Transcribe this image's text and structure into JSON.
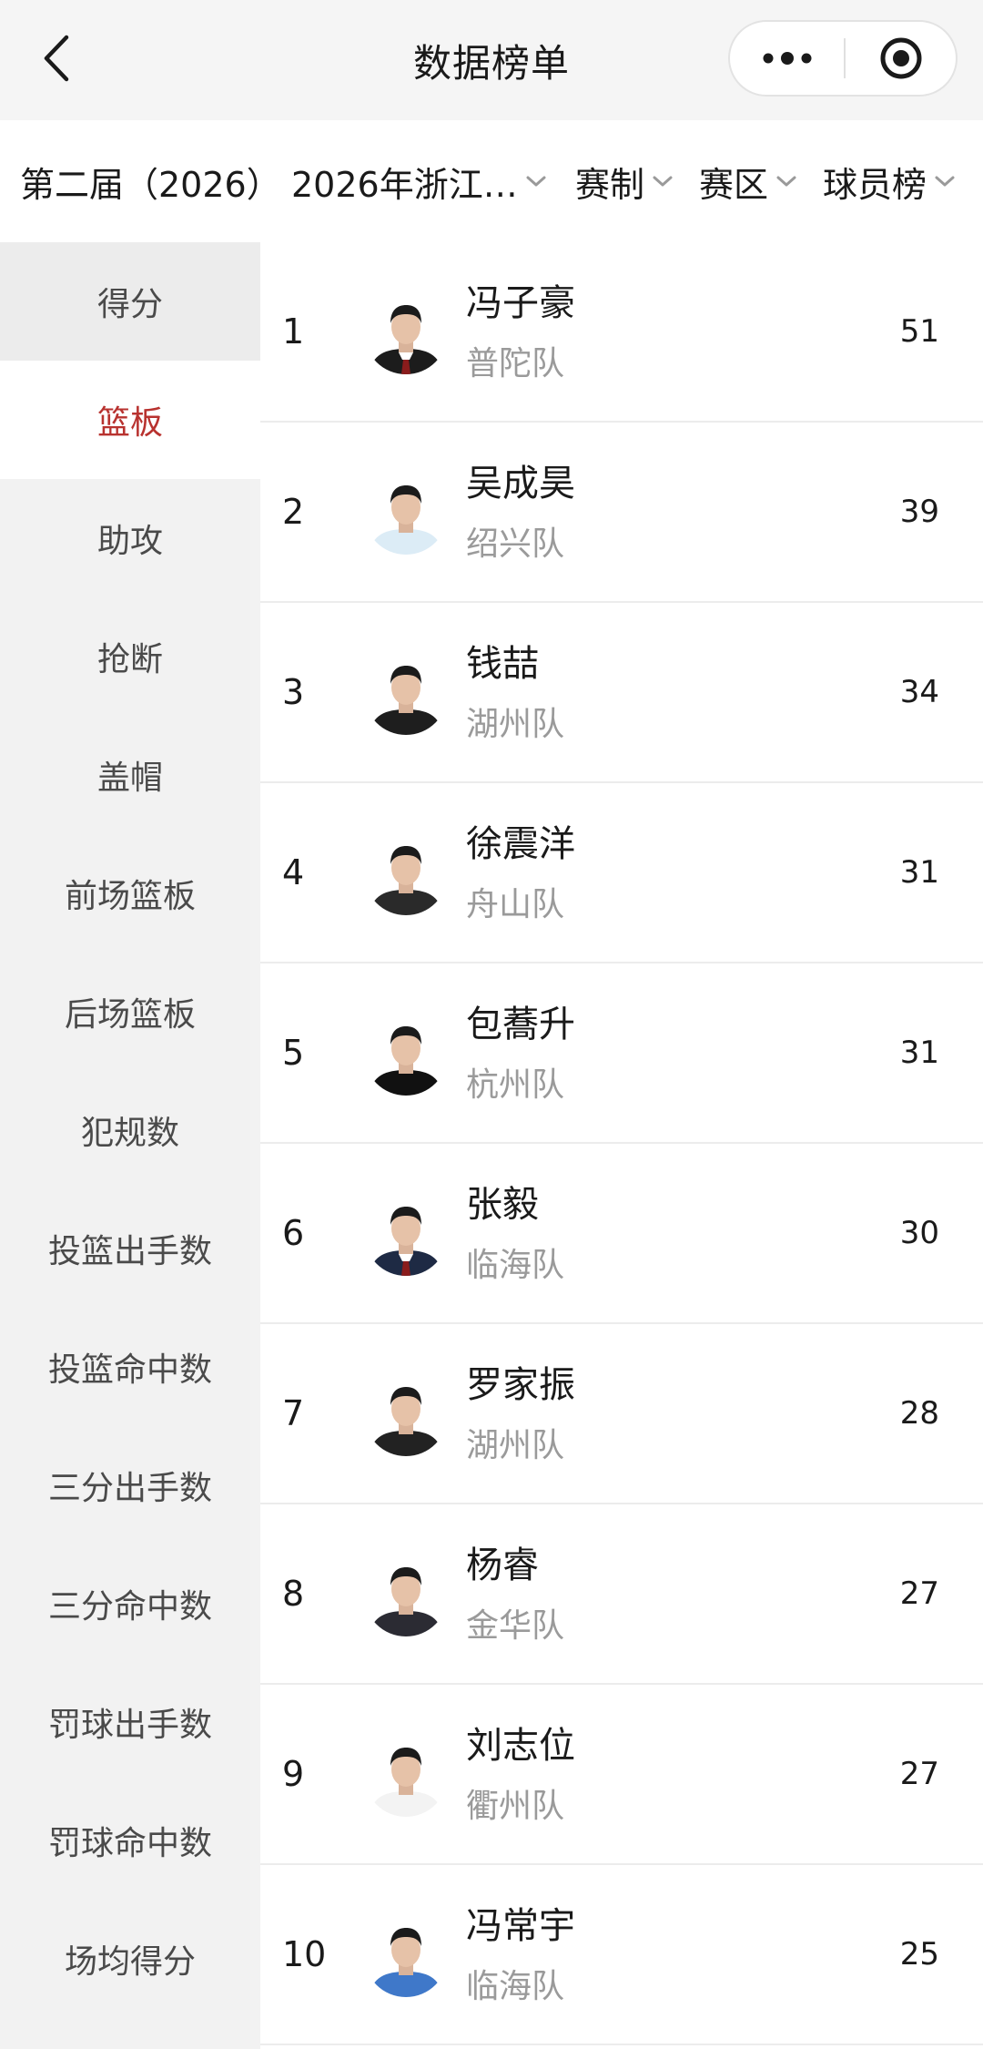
{
  "header": {
    "title": "数据榜单",
    "back_icon": "chevron-left-icon",
    "more_icon": "more-dots-icon",
    "target_icon": "record-target-icon"
  },
  "filters": {
    "season": "第二届（2026）",
    "league": "2026年浙江…",
    "format": "赛制",
    "region": "赛区",
    "board": "球员榜"
  },
  "sidebar": {
    "items": [
      {
        "label": "得分"
      },
      {
        "label": "篮板"
      },
      {
        "label": "助攻"
      },
      {
        "label": "抢断"
      },
      {
        "label": "盖帽"
      },
      {
        "label": "前场篮板"
      },
      {
        "label": "后场篮板"
      },
      {
        "label": "犯规数"
      },
      {
        "label": "投篮出手数"
      },
      {
        "label": "投篮命中数"
      },
      {
        "label": "三分出手数"
      },
      {
        "label": "三分命中数"
      },
      {
        "label": "罚球出手数"
      },
      {
        "label": "罚球命中数"
      },
      {
        "label": "场均得分"
      }
    ],
    "active_index": 1,
    "active_color": "#b8322f"
  },
  "ranking": {
    "rows": [
      {
        "rank": "1",
        "name": "冯子豪",
        "team": "普陀队",
        "value": "51",
        "shirt": "#1c1c1c",
        "tie": true
      },
      {
        "rank": "2",
        "name": "吴成昊",
        "team": "绍兴队",
        "value": "39",
        "shirt": "#dcecf6",
        "tie": false
      },
      {
        "rank": "3",
        "name": "钱喆",
        "team": "湖州队",
        "value": "34",
        "shirt": "#1e1e1e",
        "tie": false
      },
      {
        "rank": "4",
        "name": "徐震洋",
        "team": "舟山队",
        "value": "31",
        "shirt": "#2a2a2a",
        "tie": false
      },
      {
        "rank": "5",
        "name": "包蕎升",
        "team": "杭州队",
        "value": "31",
        "shirt": "#111111",
        "tie": false
      },
      {
        "rank": "6",
        "name": "张毅",
        "team": "临海队",
        "value": "30",
        "shirt": "#1e2a44",
        "tie": true
      },
      {
        "rank": "7",
        "name": "罗家振",
        "team": "湖州队",
        "value": "28",
        "shirt": "#222222",
        "tie": false
      },
      {
        "rank": "8",
        "name": "杨睿",
        "team": "金华队",
        "value": "27",
        "shirt": "#2b2b33",
        "tie": false
      },
      {
        "rank": "9",
        "name": "刘志位",
        "team": "衢州队",
        "value": "27",
        "shirt": "#f3f3f3",
        "tie": false
      },
      {
        "rank": "10",
        "name": "冯常宇",
        "team": "临海队",
        "value": "25",
        "shirt": "#3f78c9",
        "tie": false
      }
    ]
  }
}
